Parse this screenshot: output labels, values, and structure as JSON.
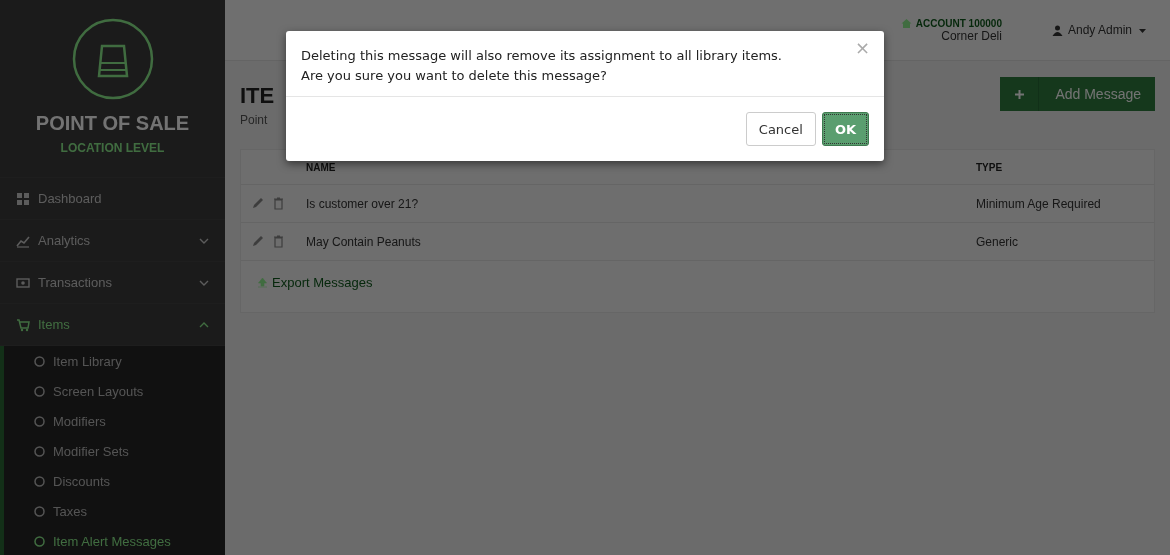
{
  "sidebar": {
    "brand": "POINT OF SALE",
    "level": "LOCATION LEVEL",
    "items": [
      {
        "label": "Dashboard",
        "kind": "link",
        "selected": false
      },
      {
        "label": "Analytics",
        "kind": "group",
        "expanded": false,
        "selected": false
      },
      {
        "label": "Transactions",
        "kind": "group",
        "expanded": false,
        "selected": false
      },
      {
        "label": "Items",
        "kind": "group",
        "expanded": true,
        "selected": true,
        "children": [
          {
            "label": "Item Library",
            "selected": false
          },
          {
            "label": "Screen Layouts",
            "selected": false
          },
          {
            "label": "Modifiers",
            "selected": false
          },
          {
            "label": "Modifier Sets",
            "selected": false
          },
          {
            "label": "Discounts",
            "selected": false
          },
          {
            "label": "Taxes",
            "selected": false
          },
          {
            "label": "Item Alert Messages",
            "selected": true
          }
        ]
      }
    ]
  },
  "header": {
    "account": "ACCOUNT 100000",
    "location": "Corner Deli",
    "user": "Andy Admin"
  },
  "page": {
    "title": "ITE",
    "subtitle": "Point",
    "add_button": "Add Message"
  },
  "table": {
    "columns": [
      "NAME",
      "TYPE"
    ],
    "rows": [
      {
        "name": "Is customer over 21?",
        "type": "Minimum Age Required"
      },
      {
        "name": "May Contain Peanuts",
        "type": "Generic"
      }
    ],
    "export_link": "Export Messages"
  },
  "dialog": {
    "message_lines": [
      "Deleting this message will also remove its assignment to all library items.",
      "Are you sure you want to delete this message?"
    ],
    "close": "×",
    "buttons": [
      {
        "label": "Cancel",
        "kind": "default"
      },
      {
        "label": "OK",
        "kind": "primary"
      }
    ]
  }
}
